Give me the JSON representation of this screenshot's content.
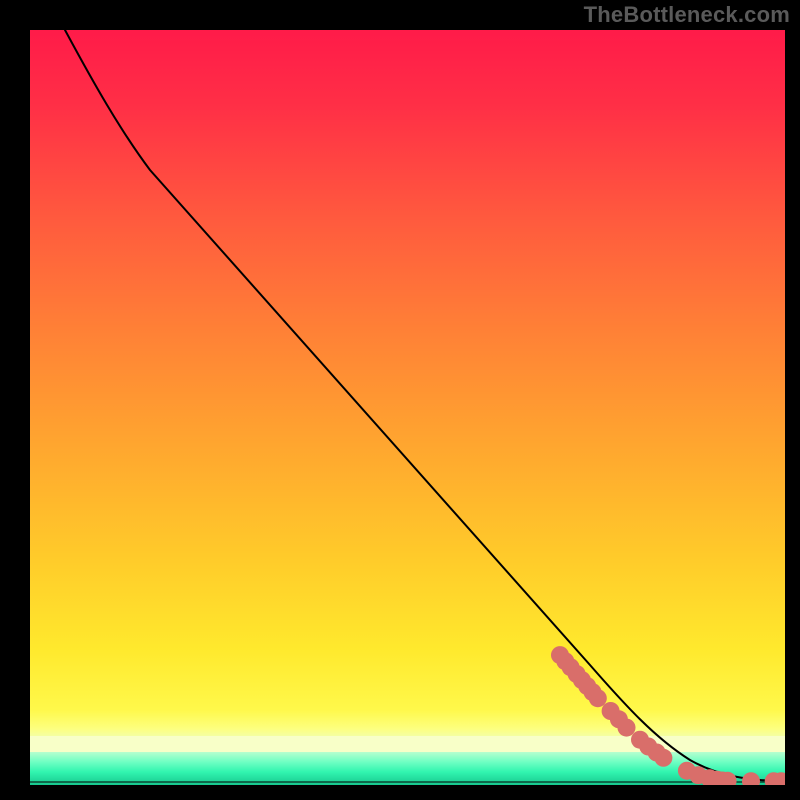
{
  "watermark": "TheBottleneck.com",
  "chart_data": {
    "type": "line",
    "title": "",
    "xlabel": "",
    "ylabel": "",
    "xlim": [
      0,
      100
    ],
    "ylim": [
      0,
      100
    ],
    "curve": {
      "x": [
        4.6,
        7,
        10,
        14,
        20,
        30,
        40,
        50,
        60,
        70,
        75,
        80,
        85,
        88,
        92,
        96,
        100
      ],
      "y": [
        100,
        94,
        88,
        82,
        75,
        63.5,
        52,
        40.5,
        29,
        17.5,
        12,
        7.5,
        4,
        2.5,
        1.2,
        0.6,
        0.5
      ]
    },
    "series": [
      {
        "name": "dots",
        "x": [
          70.2,
          70.9,
          71.6,
          72.4,
          73.1,
          73.8,
          74.5,
          75.2,
          76.9,
          78.0,
          79.0,
          80.8,
          81.9,
          83.0,
          83.9,
          87.0,
          88.5,
          90.0,
          91.0,
          91.7,
          92.4,
          95.5,
          98.5,
          99.5
        ],
        "y": [
          17.2,
          16.4,
          15.6,
          14.7,
          13.9,
          13.1,
          12.3,
          11.5,
          9.8,
          8.7,
          7.6,
          6.0,
          5.1,
          4.3,
          3.6,
          1.9,
          1.3,
          0.9,
          0.7,
          0.6,
          0.55,
          0.5,
          0.5,
          0.5
        ]
      }
    ],
    "annotations": [
      {
        "text": "TheBottleneck.com",
        "position": "top-right"
      }
    ],
    "grid": false,
    "legend": false
  }
}
